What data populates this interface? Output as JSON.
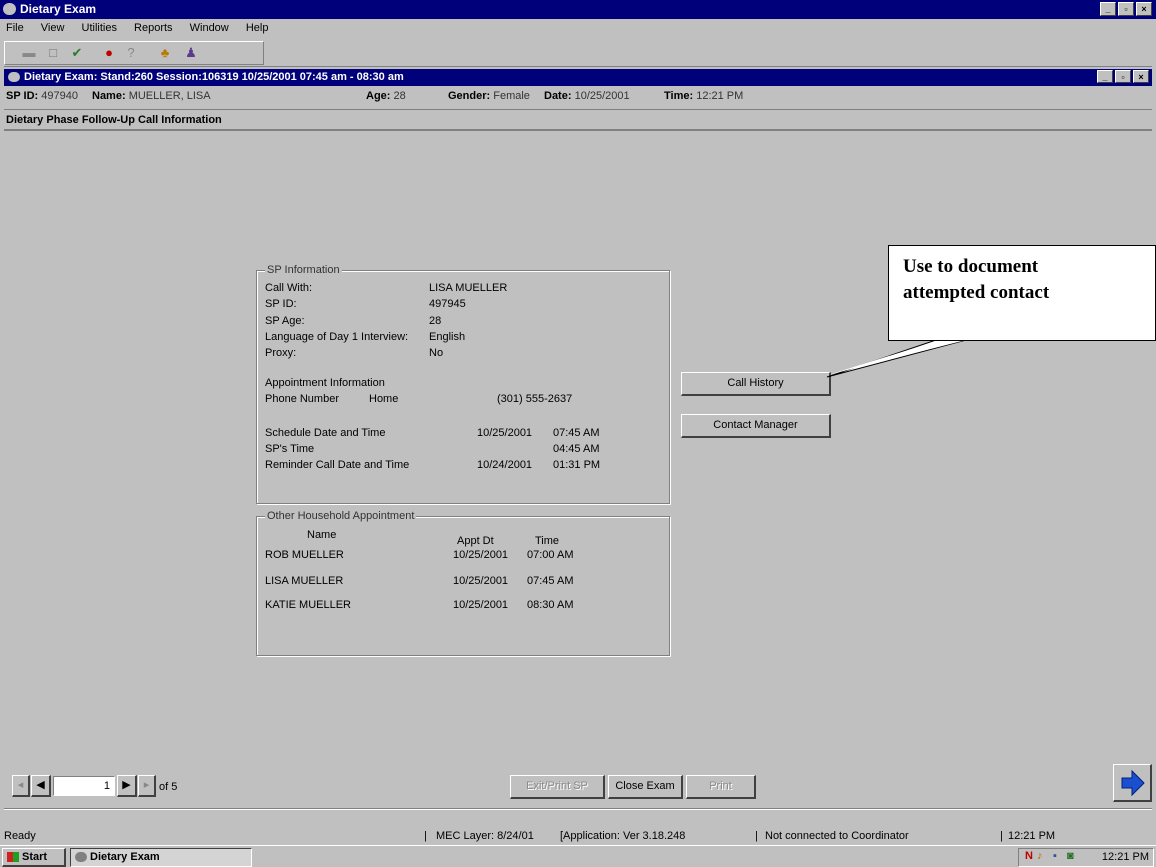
{
  "app": {
    "title": "Dietary Exam",
    "menu": [
      "File",
      "View",
      "Utilities",
      "Reports",
      "Window",
      "Help"
    ]
  },
  "child_window": {
    "title": "Dietary Exam: Stand:260 Session:106319 10/25/2001 07:45 am - 08:30 am"
  },
  "header": {
    "sp_id_label": "SP ID:",
    "sp_id": "497940",
    "name_label": "Name:",
    "name": "MUELLER, LISA",
    "age_label": "Age:",
    "age": "28",
    "gender_label": "Gender:",
    "gender": "Female",
    "date_label": "Date:",
    "date": "10/25/2001",
    "time_label": "Time:",
    "time": "12:21 PM"
  },
  "section_title": "Dietary Phase Follow-Up Call Information",
  "sp_info": {
    "legend": "SP Information",
    "rows": [
      {
        "label": "Call With:",
        "value": "LISA MUELLER"
      },
      {
        "label": "SP ID:",
        "value": "497945"
      },
      {
        "label": "SP Age:",
        "value": "28"
      },
      {
        "label": "Language of Day 1 Interview:",
        "value": "English"
      },
      {
        "label": "Proxy:",
        "value": "No"
      }
    ],
    "appt_heading": "Appointment Information",
    "phone_label": "Phone Number",
    "phone_type": "Home",
    "phone": "(301) 555-2637",
    "schedule_label": "Schedule Date and Time",
    "schedule_date": "10/25/2001",
    "schedule_time": "07:45 AM",
    "sp_time_label": "SP's Time",
    "sp_time": "04:45 AM",
    "reminder_label": "Reminder Call Date and Time",
    "reminder_date": "10/24/2001",
    "reminder_time": "01:31 PM"
  },
  "household": {
    "legend": "Other Household Appointment",
    "col_name": "Name",
    "col_date": "Appt Dt",
    "col_time": "Time",
    "rows": [
      {
        "name": "ROB MUELLER",
        "date": "10/25/2001",
        "time": "07:00 AM"
      },
      {
        "name": "LISA MUELLER",
        "date": "10/25/2001",
        "time": "07:45 AM"
      },
      {
        "name": "KATIE MUELLER",
        "date": "10/25/2001",
        "time": "08:30 AM"
      }
    ]
  },
  "buttons": {
    "call_history": "Call History",
    "contact_manager": "Contact Manager",
    "exit_sp": "Exit/Print SP",
    "close_exam": "Close Exam",
    "print": "Print"
  },
  "callout": {
    "line1": "Use to document",
    "line2": "attempted contact"
  },
  "pager": {
    "current": "1",
    "of_text": "of 5"
  },
  "status": {
    "ready": "Ready",
    "mec": "MEC Layer: 8/24/01",
    "app_ver": "[Application: Ver 3.18.248",
    "conn": "Not connected to Coordinator",
    "time": "12:21 PM"
  },
  "taskbar": {
    "start": "Start",
    "task": "Dietary Exam",
    "clock": "12:21 PM"
  }
}
